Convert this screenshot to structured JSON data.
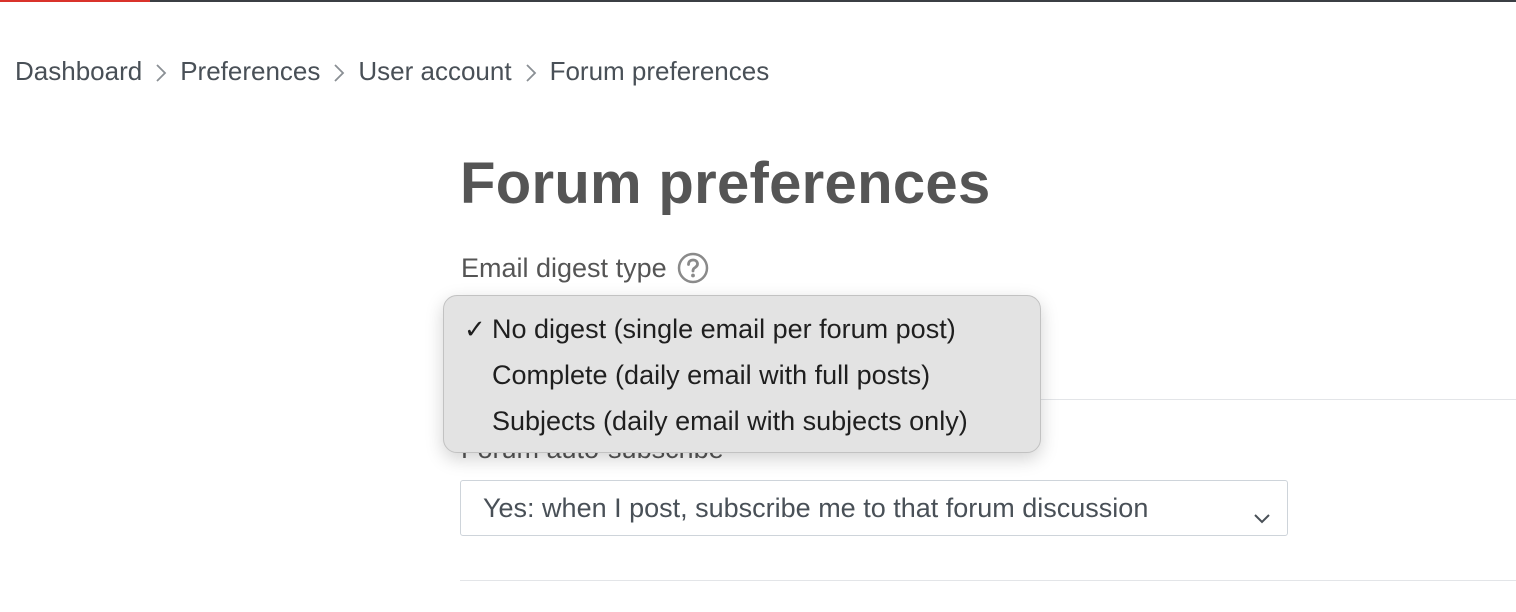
{
  "breadcrumb": {
    "items": [
      {
        "label": "Dashboard"
      },
      {
        "label": "Preferences"
      },
      {
        "label": "User account"
      },
      {
        "label": "Forum preferences"
      }
    ]
  },
  "page": {
    "title": "Forum preferences"
  },
  "email_digest": {
    "label": "Email digest type",
    "help_icon": "question-circle-icon",
    "options": [
      {
        "label": "No digest (single email per forum post)",
        "selected": true
      },
      {
        "label": "Complete (daily email with full posts)",
        "selected": false
      },
      {
        "label": "Subjects (daily email with subjects only)",
        "selected": false
      }
    ],
    "check_mark": "✓"
  },
  "auto_subscribe": {
    "label": "Forum auto-subscribe",
    "value": "Yes: when I post, subscribe me to that forum discussion",
    "icon": "chevron-down-icon"
  },
  "colors": {
    "accent": "#d9322b",
    "topbar": "#3b3f44",
    "dropdown_bg": "#e3e3e3"
  }
}
